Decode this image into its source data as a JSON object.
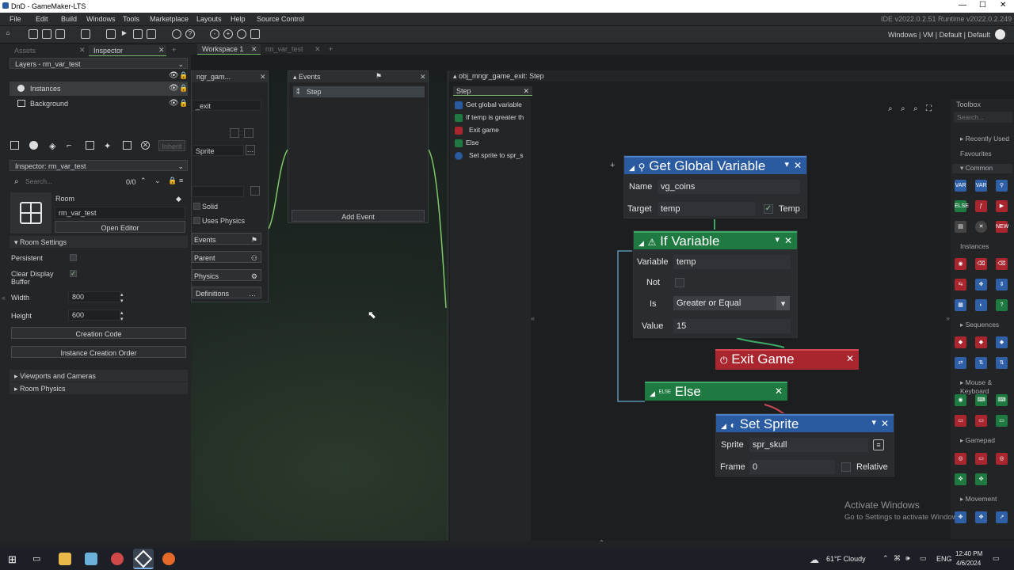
{
  "app": {
    "title": "DnD - GameMaker-LTS"
  },
  "menu": {
    "items": [
      "File",
      "Edit",
      "Build",
      "Windows",
      "Tools",
      "Marketplace",
      "Layouts",
      "Help",
      "Source Control"
    ],
    "version": "IDE v2022.0.2.51  Runtime v2022.0.2.249"
  },
  "toolbar": {
    "targets": "Windows | VM | Default | Default"
  },
  "left": {
    "tabs": [
      "Assets",
      "Inspector"
    ],
    "layers_title": "Layers - rm_var_test",
    "layers": [
      "Instances",
      "Background"
    ],
    "inherit": "Inherit",
    "inspector_title": "Inspector: rm_var_test",
    "search_placeholder": "Search...",
    "search_count": "0/0",
    "room_label": "Room",
    "room_name": "rm_var_test",
    "open_editor": "Open Editor",
    "room_settings": "Room Settings",
    "persistent": "Persistent",
    "clear_display": "Clear Display",
    "clear_display2": "Buffer",
    "width_label": "Width",
    "width": "800",
    "height_label": "Height",
    "height": "600",
    "creation_code": "Creation Code",
    "instance_order": "Instance Creation Order",
    "viewports": "Viewports and Cameras",
    "room_physics": "Room Physics"
  },
  "workspace": {
    "tabs": [
      "Workspace 1",
      "rm_var_test"
    ]
  },
  "objwin": {
    "title": "ngr_gam...",
    "name": "_exit",
    "sprite": "Sprite",
    "solid": "Solid",
    "uses_physics": "Uses Physics",
    "events": "Events",
    "parent": "Parent",
    "physics": "Physics",
    "definitions": "Definitions"
  },
  "events": {
    "title": "Events",
    "step": "Step",
    "add_event": "Add Event"
  },
  "stepwin": {
    "title": "obj_mngr_game_exit: Step",
    "tab": "Step",
    "list": [
      "Get global variable",
      "If temp is greater th",
      "Exit game",
      "Else",
      "Set sprite to spr_s"
    ]
  },
  "nodes": {
    "get_global": {
      "title": "Get Global Variable",
      "name_label": "Name",
      "name": "vg_coins",
      "target_label": "Target",
      "target": "temp",
      "temp_label": "Temp"
    },
    "if_var": {
      "title": "If Variable",
      "variable_label": "Variable",
      "variable": "temp",
      "not_label": "Not",
      "is_label": "Is",
      "is": "Greater or Equal",
      "value_label": "Value",
      "value": "15"
    },
    "exit_game": {
      "title": "Exit Game"
    },
    "else": {
      "title": "Else",
      "tag": "ELSE"
    },
    "set_sprite": {
      "title": "Set Sprite",
      "sprite_label": "Sprite",
      "sprite": "spr_skull",
      "frame_label": "Frame",
      "frame": "0",
      "relative_label": "Relative"
    }
  },
  "toolbox": {
    "title": "Toolbox",
    "search_placeholder": "Search...",
    "sections": [
      "Recently Used",
      "Favourites",
      "Common",
      "Instances",
      "Sequences",
      "Mouse & Keyboard",
      "Gamepad",
      "Movement"
    ]
  },
  "watermark": {
    "line1": "Activate Windows",
    "line2": "Go to Settings to activate Windows."
  },
  "taskbar": {
    "weather": "61°F  Cloudy",
    "lang": "ENG",
    "time": "12:40 PM",
    "date": "4/6/2024"
  }
}
